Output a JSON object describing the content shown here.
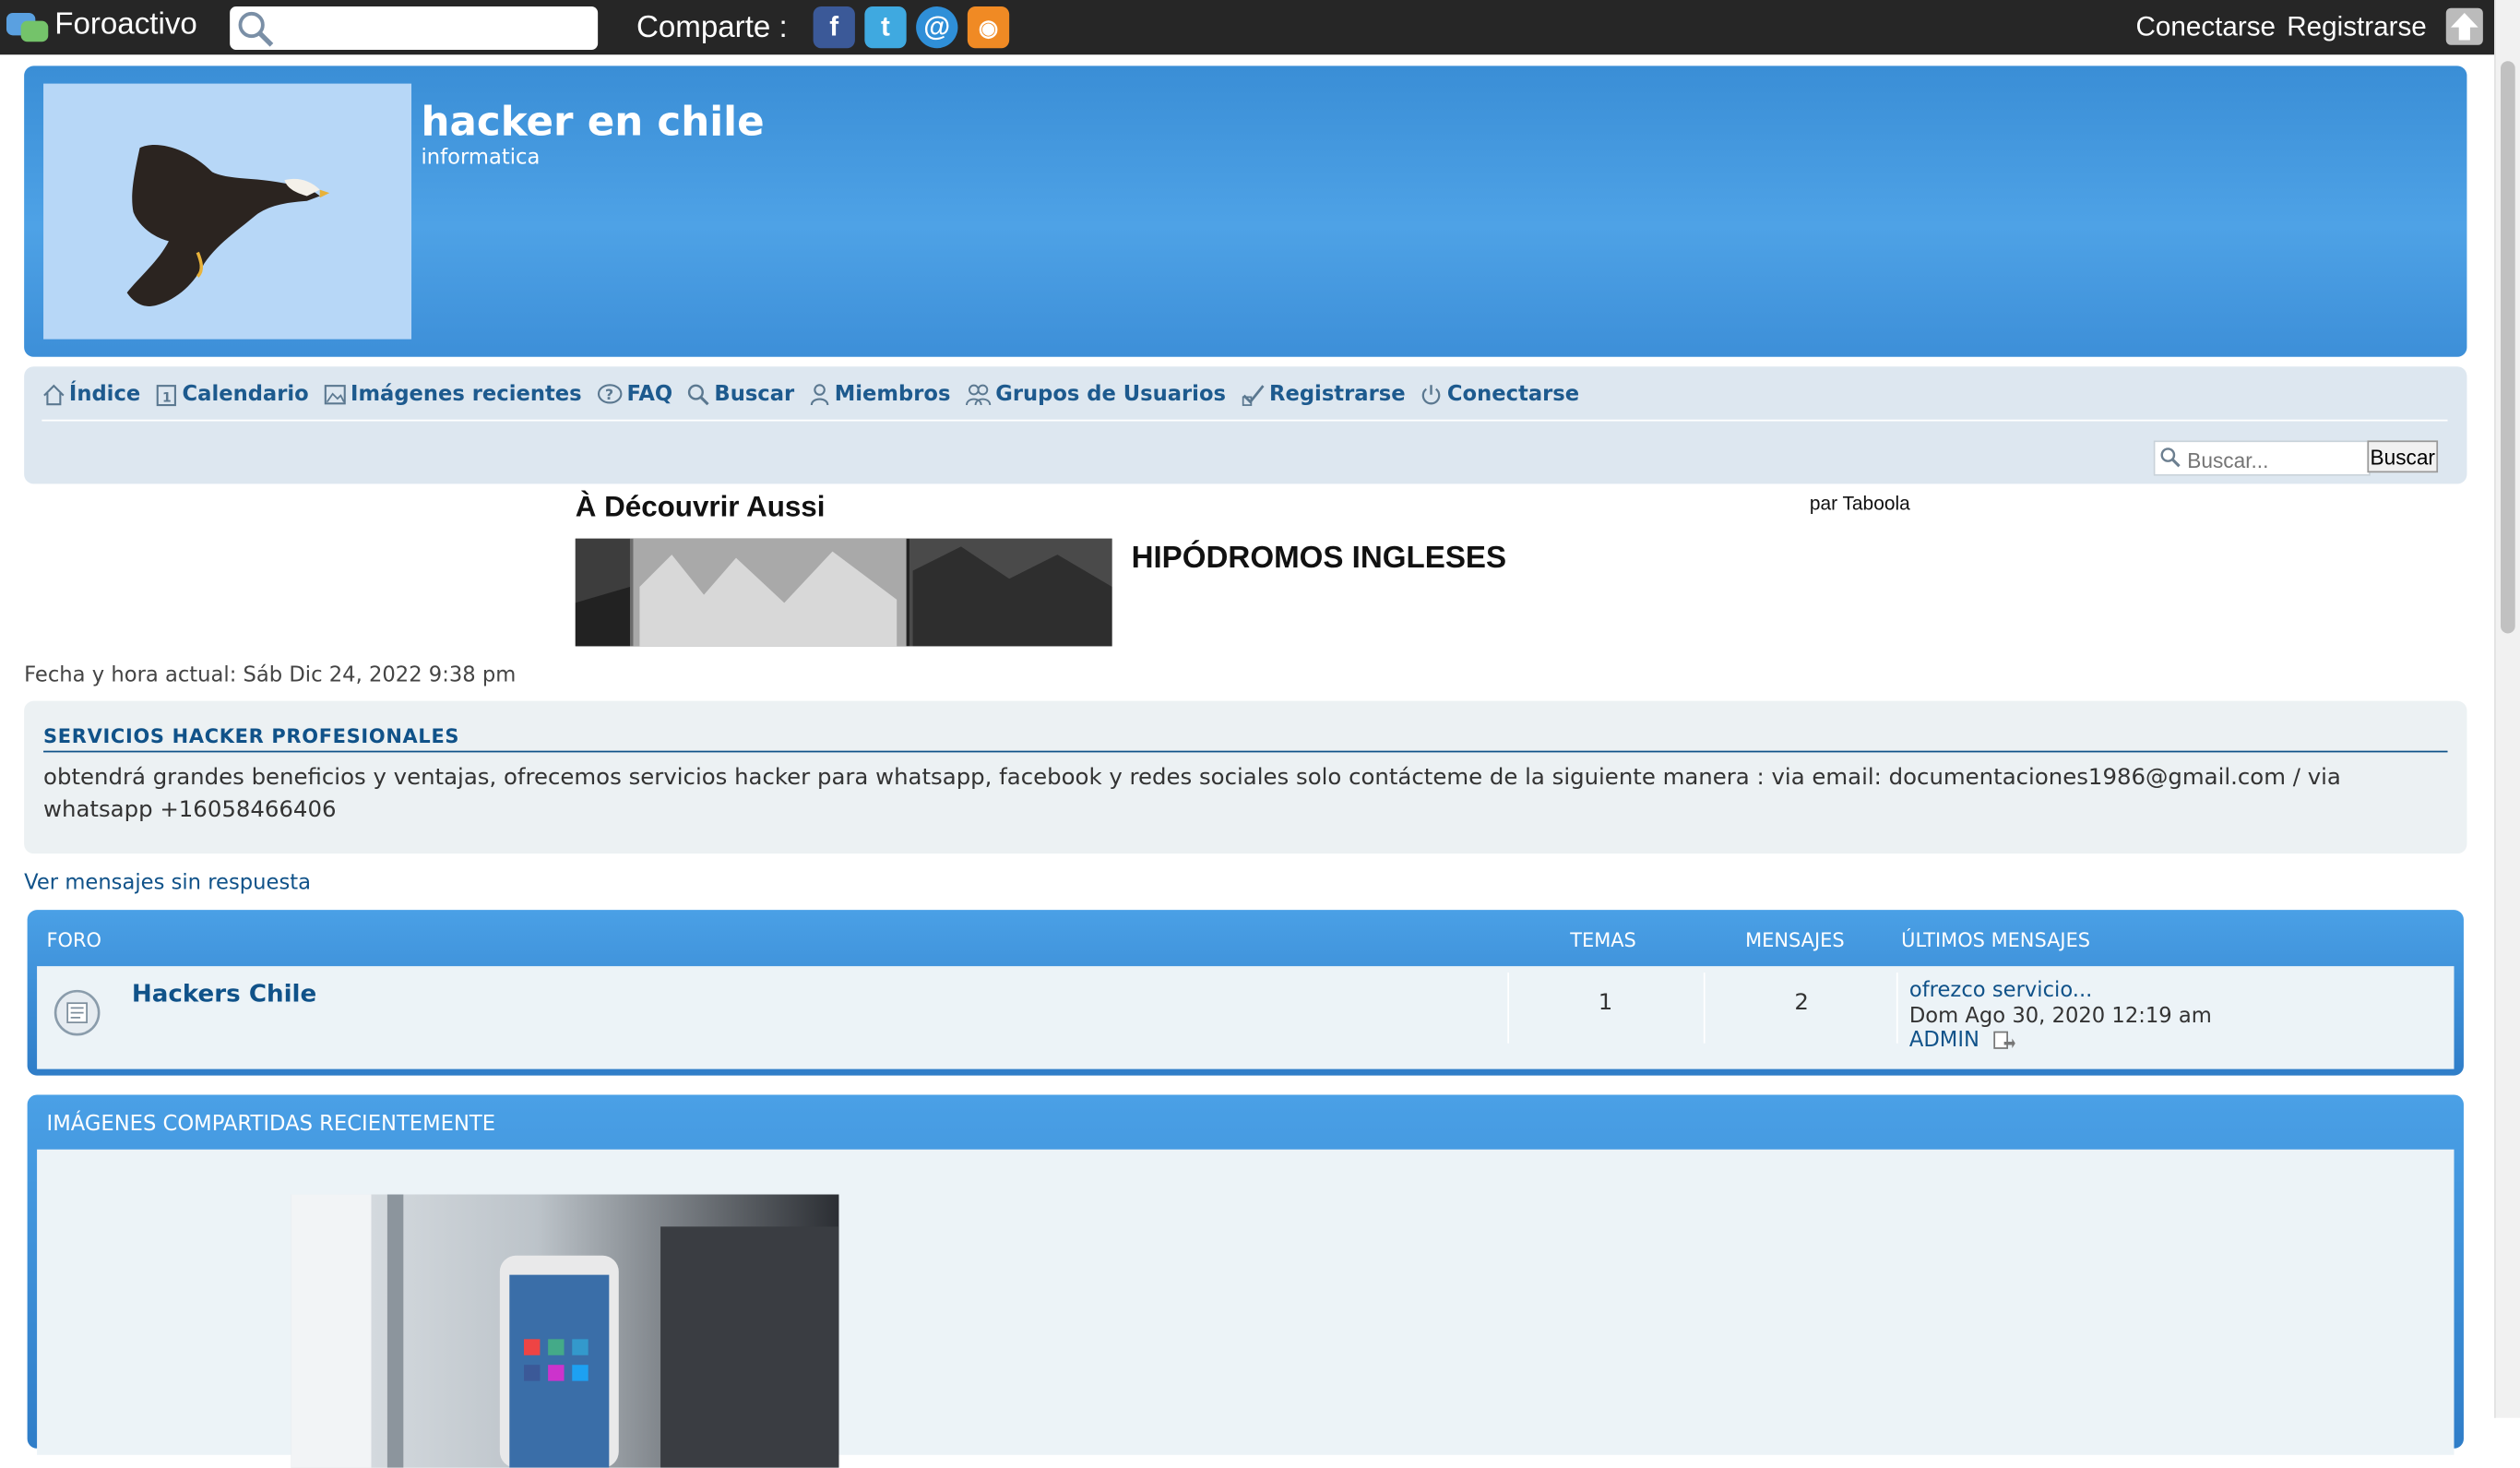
{
  "topbar": {
    "brand": "Foroactivo",
    "search_placeholder": "",
    "share_label": "Comparte :",
    "share_icons": [
      "facebook-icon",
      "twitter-icon",
      "email-icon",
      "rss-icon"
    ],
    "login": "Conectarse",
    "register": "Registrarse"
  },
  "header": {
    "title": "hacker en chile",
    "subtitle": "informatica"
  },
  "nav": {
    "items": [
      {
        "label": "Índice",
        "icon": "home-icon"
      },
      {
        "label": "Calendario",
        "icon": "calendar-icon"
      },
      {
        "label": "Imágenes recientes",
        "icon": "image-icon"
      },
      {
        "label": "FAQ",
        "icon": "faq-icon"
      },
      {
        "label": "Buscar",
        "icon": "search-icon"
      },
      {
        "label": "Miembros",
        "icon": "member-icon"
      },
      {
        "label": "Grupos de Usuarios",
        "icon": "groups-icon"
      },
      {
        "label": "Registrarse",
        "icon": "register-icon"
      },
      {
        "label": "Conectarse",
        "icon": "power-icon"
      }
    ],
    "search_placeholder": "Buscar...",
    "search_button": "Buscar"
  },
  "taboola": {
    "heading": "À Découvrir Aussi",
    "by": "par Taboola",
    "title": "HIPÓDROMOS INGLESES"
  },
  "date_line": "Fecha y hora actual: Sáb Dic 24, 2022 9:38 pm",
  "announcement": {
    "title": "SERVICIOS HACKER PROFESIONALES",
    "text": "obtendrá grandes beneficios y ventajas, ofrecemos servicios hacker para whatsapp, facebook y redes sociales solo contácteme de la siguiente manera : via email: documentaciones1986@gmail.com / via whatsapp +16058466406"
  },
  "unanswered": "Ver mensajes sin respuesta",
  "forum": {
    "headers": {
      "forum": "FORO",
      "topics": "TEMAS",
      "posts": "MENSAJES",
      "last": "ÚLTIMOS MENSAJES"
    },
    "rows": [
      {
        "name": "Hackers Chile",
        "topics": "1",
        "posts": "2",
        "last_title": "ofrezco servicio...",
        "last_date": "Dom Ago 30, 2020 12:19 am",
        "last_author": "ADMIN"
      }
    ]
  },
  "images_section": {
    "title": "IMÁGENES COMPARTIDAS RECIENTEMENTE"
  },
  "colors": {
    "topbar": "#262626",
    "header_blue": "#4ea2e6",
    "link_blue": "#105289",
    "panel_bg": "#ecf1f3"
  }
}
